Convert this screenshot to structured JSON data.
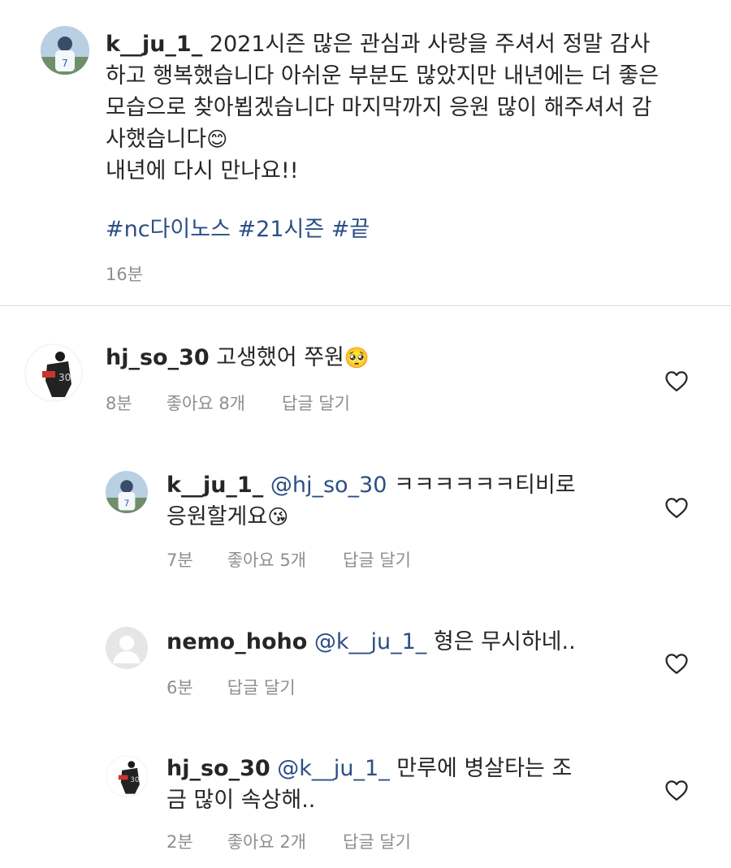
{
  "caption": {
    "username": "k__ju_1_",
    "text_line1": " 2021시즌 많은 관심과 사랑을 주셔서 정말 감사",
    "text_line2": "하고 행복했습니다 아쉬운 부분도 많았지만 내년에는 더 좋은",
    "text_line3": "모습으로 찾아뵙겠습니다 마지막까지 응원 많이 해주셔서 감",
    "text_line4": "사했습니다",
    "emoji1": "😊",
    "text_line5": "내년에 다시 만나요!!",
    "hashtags": "#nc다이노스 #21시즌 #끝",
    "time": "16분"
  },
  "comments": [
    {
      "username": "hj_so_30",
      "text": " 고생했어 쭈원",
      "emoji": "🥺",
      "time": "8분",
      "likes": "좋아요 8개",
      "reply": "답글 달기",
      "icon": "heart-outline-icon"
    },
    {
      "username": "k__ju_1_",
      "mention": "@hj_so_30",
      "text_line1": " ㅋㅋㅋㅋㅋㅋ티비로",
      "text_line2": "응원할게요",
      "emoji": "😘",
      "time": "7분",
      "likes": "좋아요 5개",
      "reply": "답글 달기",
      "icon": "heart-outline-icon"
    },
    {
      "username": "nemo_hoho",
      "mention": "@k__ju_1_",
      "text": " 형은 무시하네..",
      "time": "6분",
      "reply": "답글 달기",
      "icon": "heart-outline-icon"
    },
    {
      "username": "hj_so_30",
      "mention": "@k__ju_1_",
      "text_line1": " 만루에 병살타는 조",
      "text_line2": "금 많이 속상해..",
      "time": "2분",
      "likes": "좋아요 2개",
      "reply": "답글 달기",
      "icon": "heart-outline-icon"
    }
  ],
  "colors": {
    "text": "#262626",
    "meta": "#8e8e8e",
    "link": "#2b4f85",
    "divider": "#dbdbdb"
  }
}
